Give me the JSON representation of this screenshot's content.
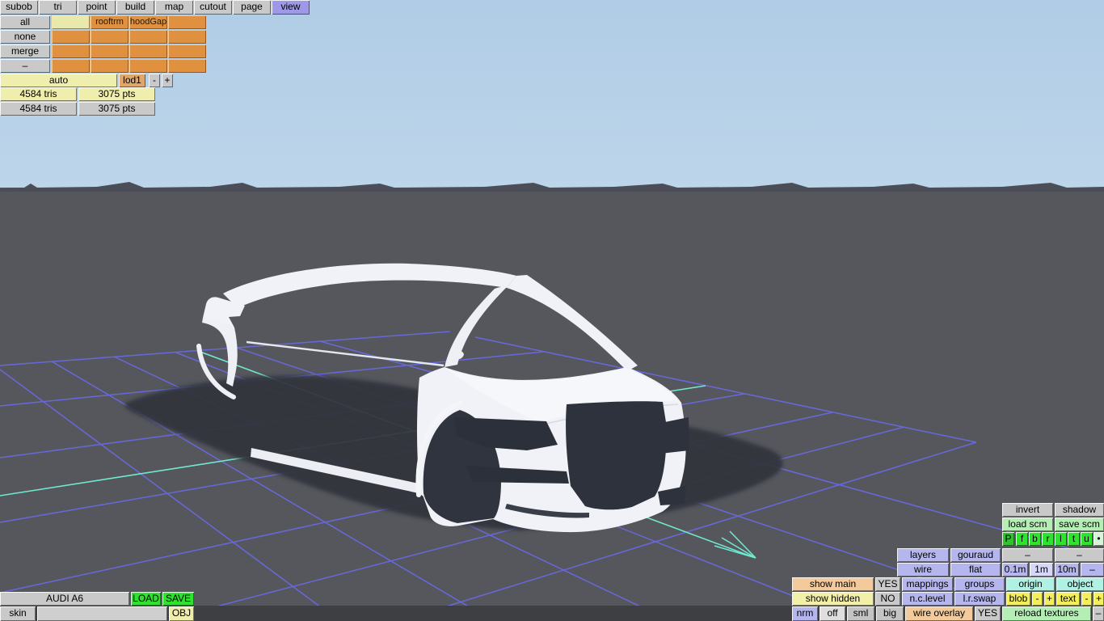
{
  "tabs": [
    "subob",
    "tri",
    "point",
    "build",
    "map",
    "cutout",
    "page",
    "view"
  ],
  "active_tab": "view",
  "layer_grid": {
    "row_buttons": [
      "all",
      "none",
      "merge",
      "–"
    ],
    "rows": [
      [
        "",
        "rooftrm",
        "hoodGap",
        ""
      ],
      [
        "",
        "",
        "",
        ""
      ],
      [
        "",
        "",
        "",
        ""
      ],
      [
        "",
        "",
        "",
        ""
      ]
    ]
  },
  "lod": {
    "auto": "auto",
    "current": "lod1",
    "dec": "-",
    "inc": "+"
  },
  "stats": {
    "sel_tris": "4584 tris",
    "sel_pts": "3075 pts",
    "tot_tris": "4584 tris",
    "tot_pts": "3075 pts"
  },
  "model": {
    "name": "AUDI A6",
    "load": "LOAD",
    "save": "SAVE",
    "skin": "skin",
    "skin_value": "",
    "format": "OBJ"
  },
  "rp": {
    "invert": "invert",
    "shadow": "shadow",
    "load_scm": "load scm",
    "save_scm": "save scm",
    "axis": [
      "P",
      "f",
      "b",
      "r",
      "l",
      "t",
      "u",
      "•"
    ],
    "layers": "layers",
    "gouraud": "gouraud",
    "dash_a": "–",
    "dash_b": "–",
    "wire": "wire",
    "flat": "flat",
    "steps": [
      "0.1m",
      "1m",
      "10m",
      "–"
    ],
    "step_selected": "1m",
    "show_main": "show main",
    "show_main_value": "YES",
    "mappings": "mappings",
    "groups": "groups",
    "origin": "origin",
    "object": "object",
    "show_hidden": "show hidden",
    "show_hidden_value": "NO",
    "nc_level": "n.c.level",
    "lr_swap": "l.r.swap",
    "blob": "blob",
    "blob_dec": "-",
    "blob_inc": "+",
    "text": "text",
    "text_dec": "-",
    "text_inc": "+",
    "nrm": "nrm",
    "off": "off",
    "sml": "sml",
    "big": "big",
    "wire_overlay": "wire overlay",
    "wire_overlay_value": "YES",
    "reload_textures": "reload textures",
    "dash_c": "–"
  },
  "colors": {
    "accent_green": "#2ee22e",
    "light_green": "#b5eeb5",
    "lavender": "#b6b6ee",
    "lavender_selected": "#d6d6f8",
    "cyan_button": "#aff2e4",
    "yellow": "#f2ef5a",
    "pale_yellow": "#f0eeac",
    "tan": "#f3ca9b",
    "cell_orange": "#e0913f",
    "tab_active": "#9d99e8",
    "grid_line": "#6a69e2",
    "axis_cyan": "#6fe9cf",
    "sky_top": "#b0cce6",
    "sky_bottom": "#bdd5ea",
    "ground": "#55575d"
  }
}
